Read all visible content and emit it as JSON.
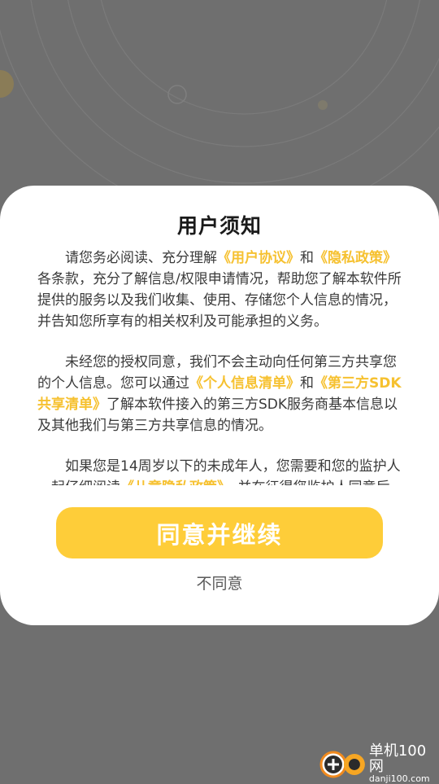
{
  "dialog": {
    "title": "用户须知",
    "paragraphs": [
      {
        "segments": [
          {
            "text": "请您务必阅读、充分理解",
            "link": false
          },
          {
            "text": "《用户协议》",
            "link": true
          },
          {
            "text": "和",
            "link": false
          },
          {
            "text": "《隐私政策》",
            "link": true
          },
          {
            "text": "各条款，充分了解信息/权限申请情况，帮助您了解本软件所提供的服务以及我们收集、使用、存储您个人信息的情况，并告知您所享有的相关权利及可能承担的义务。",
            "link": false
          }
        ]
      },
      {
        "segments": [
          {
            "text": "未经您的授权同意，我们不会主动向任何第三方共享您的个人信息。您可以通过",
            "link": false
          },
          {
            "text": "《个人信息清单》",
            "link": true
          },
          {
            "text": "和",
            "link": false
          },
          {
            "text": "《第三方SDK共享清单》",
            "link": true
          },
          {
            "text": "了解本软件接入的第三方SDK服务商基本信息以及其他我们与第三方共享信息的情况。",
            "link": false
          }
        ]
      },
      {
        "segments": [
          {
            "text": "如果您是14周岁以下的未成年人，您需要和您的监护人一起仔细阅读",
            "link": false
          },
          {
            "text": "《儿童隐私政策》",
            "link": true
          },
          {
            "text": "，并在征得您监护人同意后使用本软件。",
            "link": false
          }
        ]
      }
    ],
    "agree_label": "同意并继续",
    "disagree_label": "不同意"
  },
  "watermark": {
    "name": "单机100网",
    "url": "danji100.com"
  },
  "colors": {
    "accent": "#fecd39",
    "link": "#f6c130",
    "backdrop": "#6f6f6f"
  }
}
